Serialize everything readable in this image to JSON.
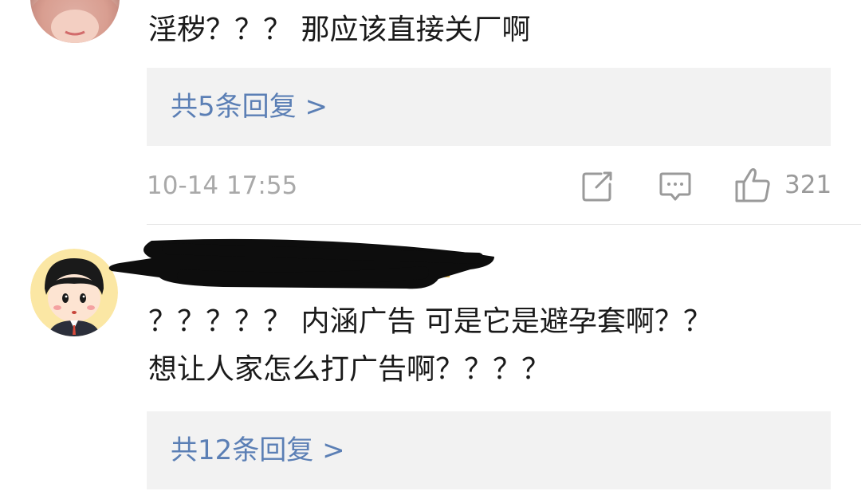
{
  "comments": [
    {
      "text": "淫秽？？？ 那应该直接关厂啊",
      "replies_label": "共5条回复 >",
      "time": "10-14 17:55",
      "likes": "321"
    },
    {
      "text_line1": "？？？？？ 内涵广告 可是它是避孕套啊？？",
      "text_line2": "想让人家怎么打广告啊？？？？",
      "replies_label": "共12条回复 >"
    }
  ],
  "icons": {
    "share": "share-icon",
    "comment": "comment-icon",
    "like": "thumbs-up-icon"
  },
  "colors": {
    "link": "#5b7fb5",
    "meta": "#a9a9a9",
    "reply_bg": "#f2f2f2"
  }
}
